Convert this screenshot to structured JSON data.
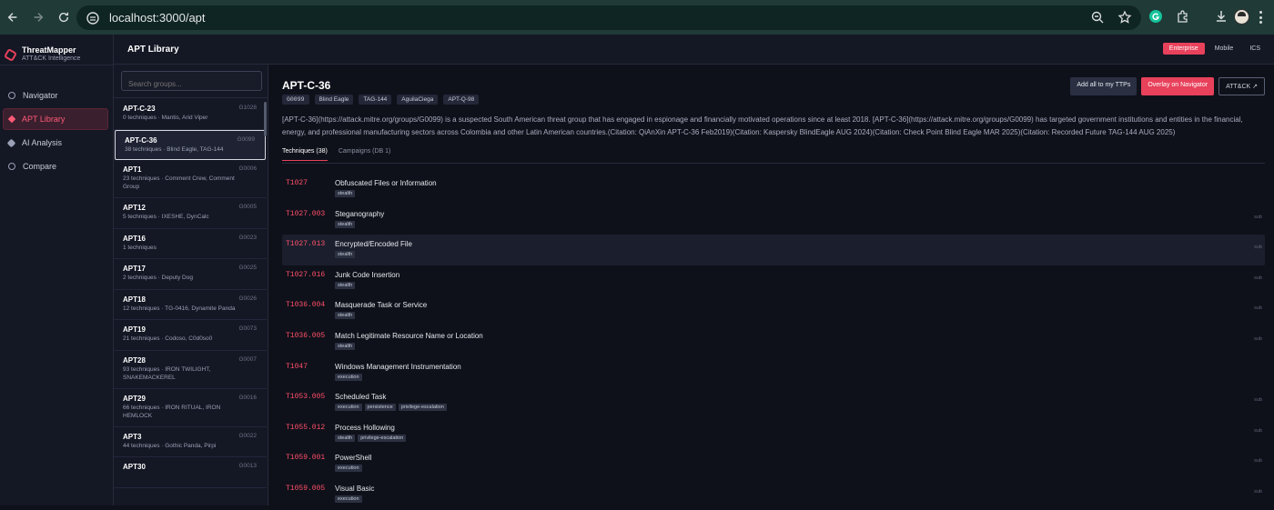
{
  "browser": {
    "url": "localhost:3000/apt"
  },
  "brand": {
    "name": "ThreatMapper",
    "subtitle": "ATT&CK Intelligence"
  },
  "nav": [
    {
      "label": "Navigator",
      "icon": "circle-icon",
      "active": false
    },
    {
      "label": "APT Library",
      "icon": "diamond-icon",
      "active": true
    },
    {
      "label": "AI Analysis",
      "icon": "hexagon-icon",
      "active": false
    },
    {
      "label": "Compare",
      "icon": "compare-icon",
      "active": false
    }
  ],
  "header": {
    "title": "APT Library",
    "matrix_tabs": [
      "Enterprise",
      "Mobile",
      "ICS"
    ],
    "active_matrix": "Enterprise"
  },
  "search": {
    "placeholder": "Search groups..."
  },
  "groups": [
    {
      "name": "APT-C-23",
      "meta": "0 techniques · Mantis, Arid Viper",
      "id": "G1028"
    },
    {
      "name": "APT-C-36",
      "meta": "38 techniques · Blind Eagle, TAG-144",
      "id": "G0099"
    },
    {
      "name": "APT1",
      "meta": "23 techniques · Comment Crew, Comment Group",
      "id": "G0006"
    },
    {
      "name": "APT12",
      "meta": "5 techniques · IXESHE, DynCalc",
      "id": "G0005"
    },
    {
      "name": "APT16",
      "meta": "1 techniques",
      "id": "G0023"
    },
    {
      "name": "APT17",
      "meta": "2 techniques · Deputy Dog",
      "id": "G0025"
    },
    {
      "name": "APT18",
      "meta": "12 techniques · TG-0416, Dynamite Panda",
      "id": "G0026"
    },
    {
      "name": "APT19",
      "meta": "21 techniques · Codoso, C0d0so0",
      "id": "G0073"
    },
    {
      "name": "APT28",
      "meta": "93 techniques · IRON TWILIGHT, SNAKEMACKEREL",
      "id": "G0007"
    },
    {
      "name": "APT29",
      "meta": "66 techniques · IRON RITUAL, IRON HEMLOCK",
      "id": "G0016"
    },
    {
      "name": "APT3",
      "meta": "44 techniques · Gothic Panda, Pirpi",
      "id": "G0022"
    },
    {
      "name": "APT30",
      "meta": "",
      "id": "G0013"
    }
  ],
  "detail": {
    "title": "APT-C-36",
    "aliases": [
      "G0099",
      "Blind Eagle",
      "TAG-144",
      "AguilaCiega",
      "APT-Q-98"
    ],
    "actions": {
      "add_all": "Add all to my TTPs",
      "overlay": "Overlay on Navigator",
      "attack": "ATT&CK ↗"
    },
    "description": "[APT-C-36](https://attack.mitre.org/groups/G0099) is a suspected South American threat group that has engaged in espionage and financially motivated operations since at least 2018. [APT-C-36](https://attack.mitre.org/groups/G0099) has targeted government institutions and entities in the financial, energy, and professional manufacturing sectors across Colombia and other Latin American countries.(Citation: QiAnXin APT-C-36 Feb2019)(Citation: Kaspersky BlindEagle AUG 2024)(Citation: Check Point Blind Eagle MAR 2025)(Citation: Recorded Future TAG-144 AUG 2025)",
    "tabs": [
      "Techniques (38)",
      "Campaigns (DB 1)"
    ],
    "techniques": [
      {
        "id": "T1027",
        "name": "Obfuscated Files or Information",
        "tags": [
          "stealth"
        ],
        "sub": ""
      },
      {
        "id": "T1027.003",
        "name": "Steganography",
        "tags": [
          "stealth"
        ],
        "sub": "sub"
      },
      {
        "id": "T1027.013",
        "name": "Encrypted/Encoded File",
        "tags": [
          "stealth"
        ],
        "sub": "sub"
      },
      {
        "id": "T1027.016",
        "name": "Junk Code Insertion",
        "tags": [
          "stealth"
        ],
        "sub": "sub"
      },
      {
        "id": "T1036.004",
        "name": "Masquerade Task or Service",
        "tags": [
          "stealth"
        ],
        "sub": "sub"
      },
      {
        "id": "T1036.005",
        "name": "Match Legitimate Resource Name or Location",
        "tags": [
          "stealth"
        ],
        "sub": "sub"
      },
      {
        "id": "T1047",
        "name": "Windows Management Instrumentation",
        "tags": [
          "execution"
        ],
        "sub": ""
      },
      {
        "id": "T1053.005",
        "name": "Scheduled Task",
        "tags": [
          "execution",
          "persistence",
          "privilege-escalation"
        ],
        "sub": "sub"
      },
      {
        "id": "T1055.012",
        "name": "Process Hollowing",
        "tags": [
          "stealth",
          "privilege-escalation"
        ],
        "sub": "sub"
      },
      {
        "id": "T1059.001",
        "name": "PowerShell",
        "tags": [
          "execution"
        ],
        "sub": "sub"
      },
      {
        "id": "T1059.005",
        "name": "Visual Basic",
        "tags": [
          "execution"
        ],
        "sub": "sub"
      }
    ]
  },
  "colors": {
    "accent": "#e8415b",
    "technique_id": "#ff4f6a",
    "background": "#0f111a",
    "panel": "#141724"
  }
}
